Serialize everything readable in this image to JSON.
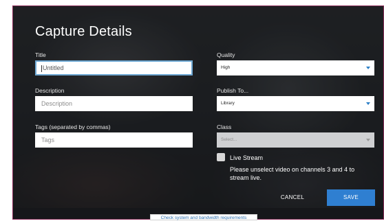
{
  "dialog": {
    "title": "Capture Details"
  },
  "fields": {
    "title_label": "Title",
    "title_value": "Untitled",
    "description_label": "Description",
    "description_placeholder": "Description",
    "tags_label": "Tags (separated by commas)",
    "tags_placeholder": "Tags",
    "quality_label": "Quality",
    "quality_value": "High",
    "publish_label": "Publish To...",
    "publish_value": "Library",
    "class_label": "Class",
    "class_placeholder": "Select..."
  },
  "live_stream": {
    "label": "Live Stream",
    "checked": false,
    "note": "Please unselect video on channels 3 and 4 to stream live."
  },
  "actions": {
    "cancel_label": "CANCEL",
    "save_label": "SAVE"
  },
  "footer": {
    "requirements_link": "Check system and bandwidth requirements"
  },
  "colors": {
    "accent": "#2f7fd1",
    "focus_border": "#6ea8d3",
    "window_border": "#8a2b58",
    "link": "#2b6fb0"
  }
}
